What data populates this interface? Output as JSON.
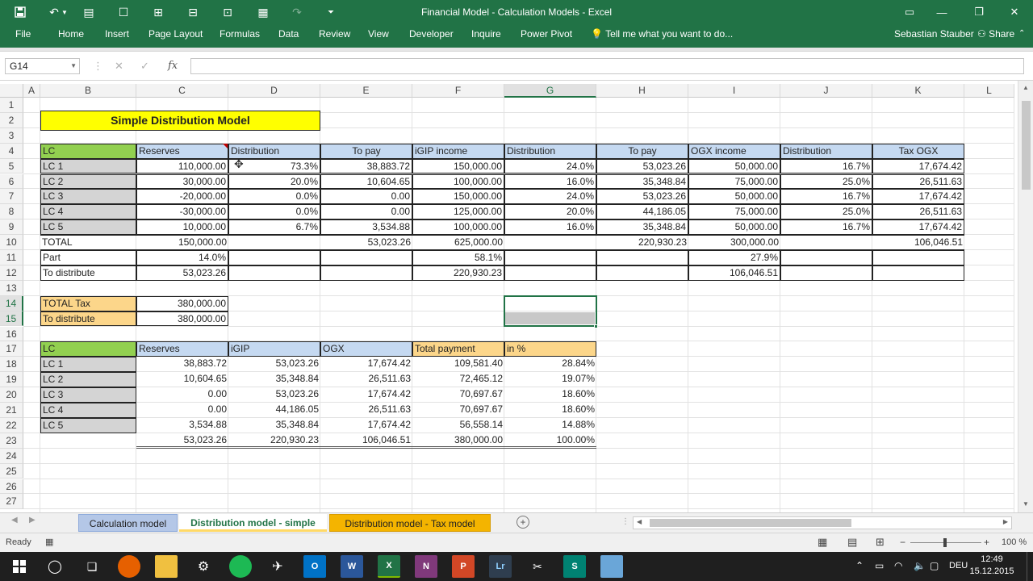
{
  "window": {
    "title": "Financial Model - Calculation Models - Excel"
  },
  "colors": {
    "excel_green": "#217346",
    "header_green": "#92d050",
    "header_blue": "#c5d9f1",
    "header_orange": "#fcd68a",
    "title_yellow": "#ffff00",
    "row_gray": "#d4d4d4",
    "tab_blue": "#b4c7e7",
    "tab_yellow": "#ffd966",
    "tab_orange": "#f4b400"
  },
  "ribbon": {
    "file": "File",
    "tabs": [
      "Home",
      "Insert",
      "Page Layout",
      "Formulas",
      "Data",
      "Review",
      "View",
      "Developer",
      "Inquire",
      "Power Pivot"
    ],
    "tell_me": "Tell me what you want to do...",
    "user": "Sebastian Stauber",
    "share": "Share"
  },
  "formula_bar": {
    "name_box": "G14",
    "fx": "fx",
    "formula": ""
  },
  "columns": [
    "A",
    "B",
    "C",
    "D",
    "E",
    "F",
    "G",
    "H",
    "I",
    "J",
    "K",
    "L"
  ],
  "rows": [
    "1",
    "2",
    "3",
    "4",
    "5",
    "6",
    "7",
    "8",
    "9",
    "10",
    "11",
    "12",
    "13",
    "14",
    "15",
    "16",
    "17",
    "18",
    "19",
    "20",
    "21",
    "22",
    "23",
    "24",
    "25",
    "26",
    "27"
  ],
  "sheet": {
    "title": "Simple Distribution Model",
    "top_headers": [
      "LC",
      "Reserves",
      "Distribution",
      "To pay",
      "iGIP income",
      "Distribution",
      "To pay",
      "OGX income",
      "Distribution",
      "Tax OGX"
    ],
    "top_rows": [
      [
        "LC 1",
        "110,000.00",
        "73.3%",
        "38,883.72",
        "150,000.00",
        "24.0%",
        "53,023.26",
        "50,000.00",
        "16.7%",
        "17,674.42"
      ],
      [
        "LC 2",
        "30,000.00",
        "20.0%",
        "10,604.65",
        "100,000.00",
        "16.0%",
        "35,348.84",
        "75,000.00",
        "25.0%",
        "26,511.63"
      ],
      [
        "LC 3",
        "-20,000.00",
        "0.0%",
        "0.00",
        "150,000.00",
        "24.0%",
        "53,023.26",
        "50,000.00",
        "16.7%",
        "17,674.42"
      ],
      [
        "LC 4",
        "-30,000.00",
        "0.0%",
        "0.00",
        "125,000.00",
        "20.0%",
        "44,186.05",
        "75,000.00",
        "25.0%",
        "26,511.63"
      ],
      [
        "LC 5",
        "10,000.00",
        "6.7%",
        "3,534.88",
        "100,000.00",
        "16.0%",
        "35,348.84",
        "50,000.00",
        "16.7%",
        "17,674.42"
      ]
    ],
    "total_row": [
      "TOTAL",
      "150,000.00",
      "",
      "53,023.26",
      "625,000.00",
      "",
      "220,930.23",
      "300,000.00",
      "",
      "106,046.51"
    ],
    "part_row": [
      "Part",
      "14.0%",
      "",
      "",
      "58.1%",
      "",
      "",
      "27.9%",
      "",
      ""
    ],
    "distribute_row": [
      "To distribute",
      "53,023.26",
      "",
      "",
      "220,930.23",
      "",
      "",
      "106,046.51",
      "",
      ""
    ],
    "tax_rows": [
      [
        "TOTAL Tax",
        "380,000.00"
      ],
      [
        "To distribute",
        "380,000.00"
      ]
    ],
    "bottom_headers": [
      "LC",
      "Reserves",
      "iGIP",
      "OGX",
      "Total payment",
      "in %"
    ],
    "bottom_rows": [
      [
        "LC 1",
        "38,883.72",
        "53,023.26",
        "17,674.42",
        "109,581.40",
        "28.84%"
      ],
      [
        "LC 2",
        "10,604.65",
        "35,348.84",
        "26,511.63",
        "72,465.12",
        "19.07%"
      ],
      [
        "LC 3",
        "0.00",
        "53,023.26",
        "17,674.42",
        "70,697.67",
        "18.60%"
      ],
      [
        "LC 4",
        "0.00",
        "44,186.05",
        "26,511.63",
        "70,697.67",
        "18.60%"
      ],
      [
        "LC 5",
        "3,534.88",
        "35,348.84",
        "17,674.42",
        "56,558.14",
        "14.88%"
      ]
    ],
    "bottom_total": [
      "",
      "53,023.26",
      "220,930.23",
      "106,046.51",
      "380,000.00",
      "100.00%"
    ]
  },
  "sheet_tabs": [
    {
      "label": "Calculation model"
    },
    {
      "label": "Distribution model - simple"
    },
    {
      "label": "Distribution model - Tax model"
    }
  ],
  "status": {
    "ready": "Ready",
    "zoom": "100 %"
  },
  "taskbar": {
    "lang": "DEU",
    "time": "12:49",
    "date": "15.12.2015"
  }
}
